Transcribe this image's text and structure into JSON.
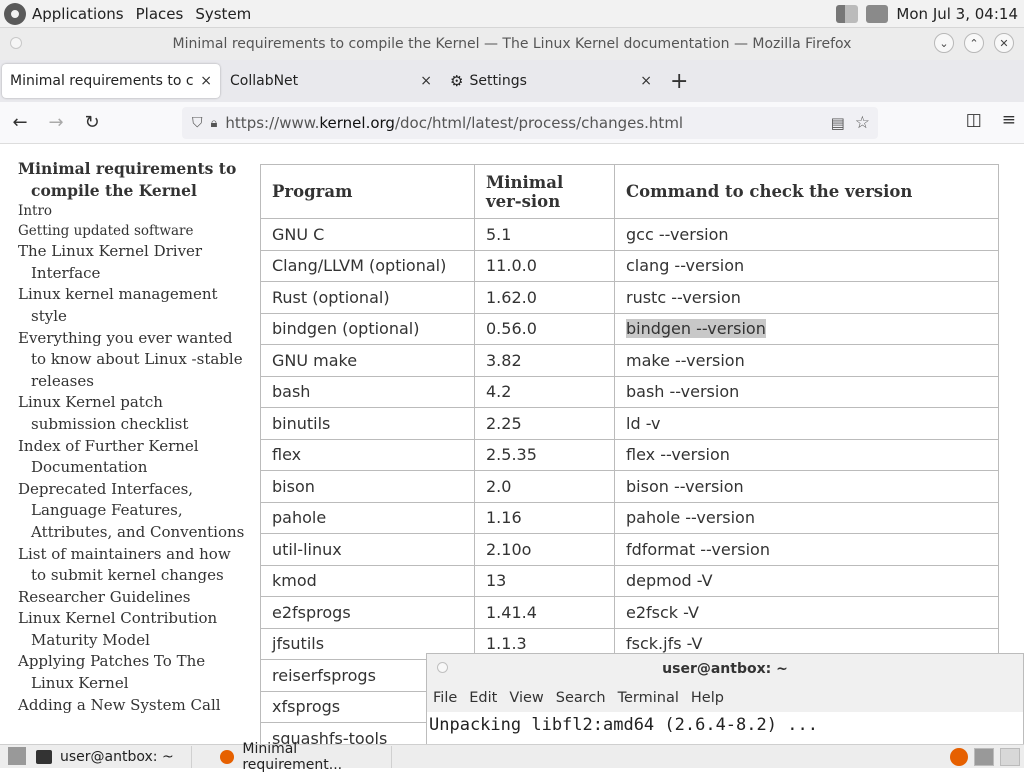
{
  "top_panel": {
    "menus": [
      "Applications",
      "Places",
      "System"
    ],
    "clock": "Mon Jul 3, 04:14"
  },
  "window": {
    "title": "Minimal requirements to compile the Kernel — The Linux Kernel documentation — Mozilla Firefox"
  },
  "tabs": [
    {
      "label": "Minimal requirements to com",
      "close": "×"
    },
    {
      "label": "CollabNet",
      "close": "×"
    },
    {
      "label": "Settings",
      "close": "×"
    }
  ],
  "new_tab_label": "+",
  "url": {
    "prefix": "https://www.",
    "domain": "kernel.org",
    "path": "/doc/html/latest/process/changes.html"
  },
  "sidebar": [
    {
      "label": "Minimal requirements to compile the Kernel",
      "bold": true
    },
    {
      "label": "Intro",
      "sub": true
    },
    {
      "label": "Getting updated software",
      "sub": true
    },
    {
      "label": "The Linux Kernel Driver Interface"
    },
    {
      "label": "Linux kernel management style"
    },
    {
      "label": "Everything you ever wanted to know about Linux -stable releases"
    },
    {
      "label": "Linux Kernel patch submission checklist"
    },
    {
      "label": "Index of Further Kernel Documentation"
    },
    {
      "label": "Deprecated Interfaces, Language Features, Attributes, and Conventions"
    },
    {
      "label": "List of maintainers and how to submit kernel changes"
    },
    {
      "label": "Researcher Guidelines"
    },
    {
      "label": "Linux Kernel Contribution Maturity Model"
    },
    {
      "label": "Applying Patches To The Linux Kernel"
    },
    {
      "label": "Adding a New System Call"
    }
  ],
  "table": {
    "headers": [
      "Program",
      "Minimal ver-sion",
      "Command to check the version"
    ],
    "rows": [
      [
        "GNU C",
        "5.1",
        "gcc --version"
      ],
      [
        "Clang/LLVM (optional)",
        "11.0.0",
        "clang --version"
      ],
      [
        "Rust (optional)",
        "1.62.0",
        "rustc --version"
      ],
      [
        "bindgen (optional)",
        "0.56.0",
        "bindgen --version"
      ],
      [
        "GNU make",
        "3.82",
        "make --version"
      ],
      [
        "bash",
        "4.2",
        "bash --version"
      ],
      [
        "binutils",
        "2.25",
        "ld -v"
      ],
      [
        "flex",
        "2.5.35",
        "flex --version"
      ],
      [
        "bison",
        "2.0",
        "bison --version"
      ],
      [
        "pahole",
        "1.16",
        "pahole --version"
      ],
      [
        "util-linux",
        "2.10o",
        "fdformat --version"
      ],
      [
        "kmod",
        "13",
        "depmod -V"
      ],
      [
        "e2fsprogs",
        "1.41.4",
        "e2fsck -V"
      ],
      [
        "jfsutils",
        "1.1.3",
        "fsck.jfs -V"
      ],
      [
        "reiserfsprogs",
        "",
        ""
      ],
      [
        "xfsprogs",
        "",
        ""
      ],
      [
        "squashfs-tools",
        "",
        ""
      ]
    ],
    "highlighted_row": 3
  },
  "terminal": {
    "title": "user@antbox: ~",
    "menus": [
      "File",
      "Edit",
      "View",
      "Search",
      "Terminal",
      "Help"
    ],
    "line": "Unpacking libfl2:amd64 (2.6.4-8.2) ..."
  },
  "taskbar": {
    "tasks": [
      "user@antbox: ~",
      "Minimal requirement..."
    ]
  }
}
